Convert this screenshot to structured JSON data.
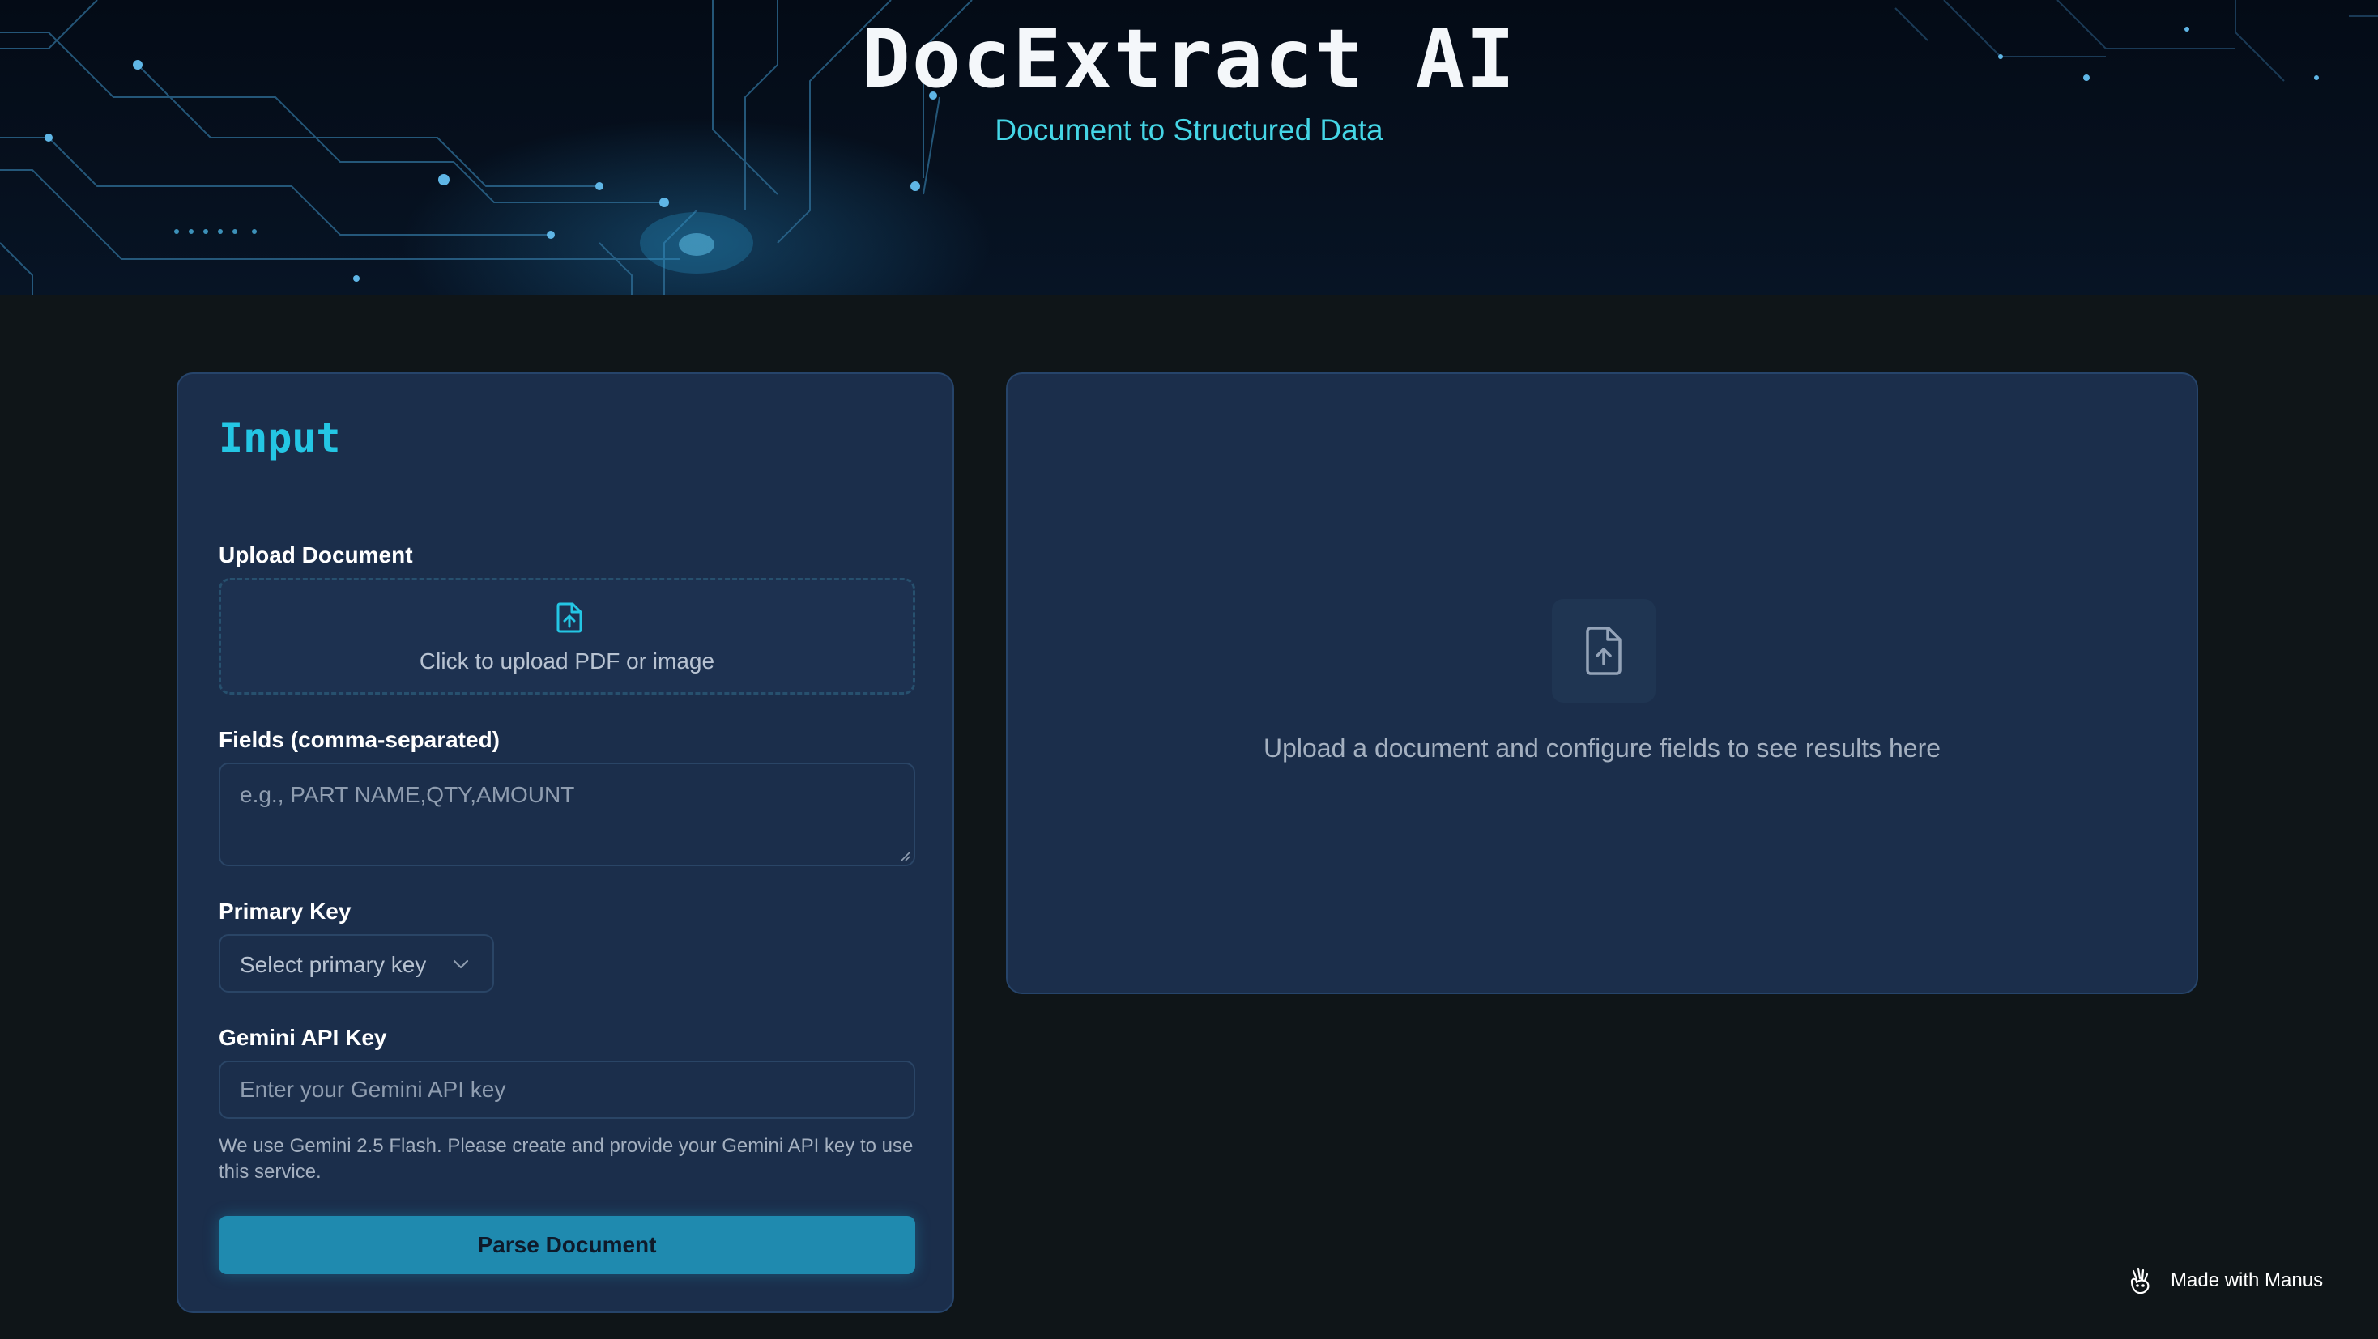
{
  "hero": {
    "title": "DocExtract AI",
    "subtitle": "Document to Structured Data"
  },
  "input_panel": {
    "heading": "Input",
    "upload": {
      "label": "Upload Document",
      "prompt": "Click to upload PDF or image",
      "icon": "file-upload-icon"
    },
    "fields": {
      "label": "Fields (comma-separated)",
      "placeholder": "e.g., PART NAME,QTY,AMOUNT"
    },
    "primary_key": {
      "label": "Primary Key",
      "selected": "Select primary key",
      "icon": "chevron-down-icon"
    },
    "api_key": {
      "label": "Gemini API Key",
      "placeholder": "Enter your Gemini API key",
      "help": "We use Gemini 2.5 Flash. Please create and provide your Gemini API key to use this service."
    },
    "submit_label": "Parse Document"
  },
  "output_panel": {
    "empty_message": "Upload a document and configure fields to see results here",
    "icon": "file-upload-icon"
  },
  "badge": {
    "text": "Made with Manus",
    "icon": "manus-hand-icon"
  },
  "colors": {
    "accent": "#24c6e4",
    "subtitle": "#45d6e6",
    "button": "#1f8aaf",
    "card": "#1b2e4b",
    "background": "#0f1518"
  }
}
